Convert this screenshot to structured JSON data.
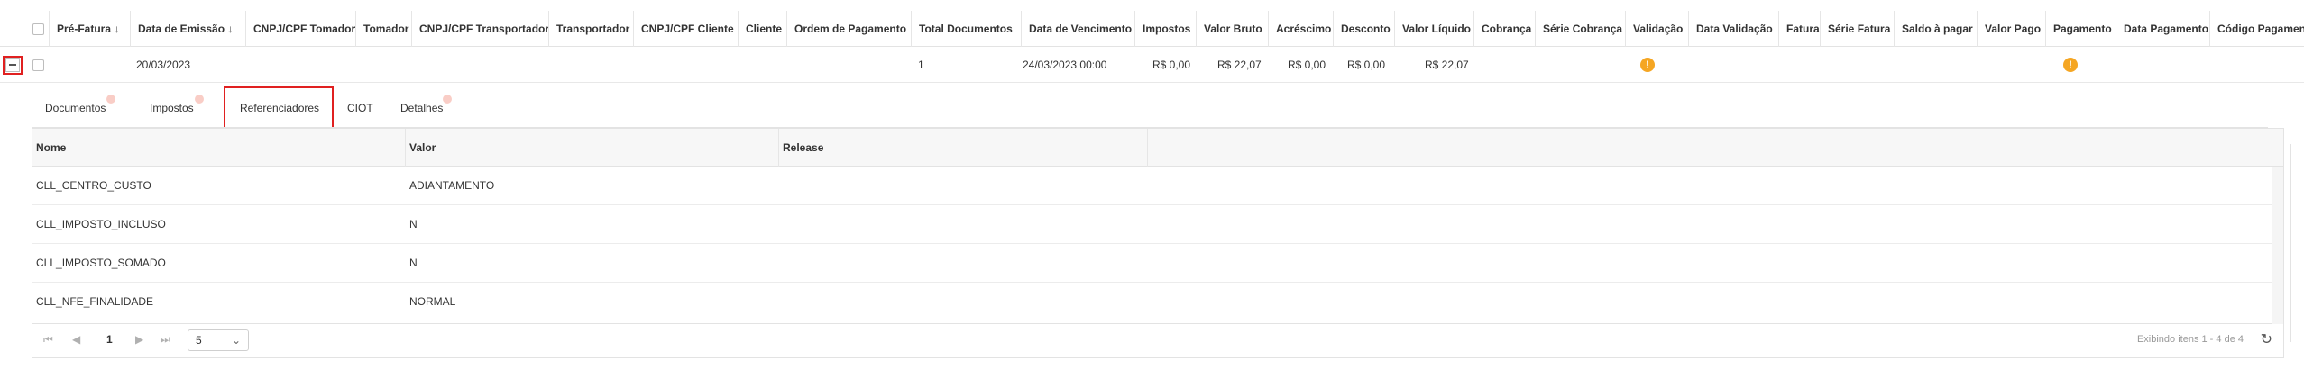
{
  "grid": {
    "columns": [
      "Pré-Fatura ↓",
      "Data de Emissão ↓",
      "CNPJ/CPF Tomador",
      "Tomador",
      "CNPJ/CPF Transportador",
      "Transportador",
      "CNPJ/CPF Cliente",
      "Cliente",
      "Ordem de Pagamento",
      "Total Documentos",
      "Data de Vencimento",
      "Impostos",
      "Valor Bruto",
      "Acréscimo",
      "Desconto",
      "Valor Líquido",
      "Cobrança",
      "Série Cobrança",
      "Validação",
      "Data Validação",
      "Fatura",
      "Série Fatura",
      "Saldo à pagar",
      "Valor Pago",
      "Pagamento",
      "Data Pagamento",
      "Código Pagamento"
    ],
    "row": {
      "data_emissao": "20/03/2023",
      "total_documentos": "1",
      "data_vencimento": "24/03/2023 00:00",
      "impostos": "R$ 0,00",
      "valor_bruto": "R$ 22,07",
      "acrescimo": "R$ 0,00",
      "desconto": "R$ 0,00",
      "valor_liquido": "R$ 22,07",
      "validacao_icon": "warning-icon",
      "pagamento_icon": "warning-icon",
      "warn_glyph": "!"
    }
  },
  "tabs": [
    {
      "label": "Documentos",
      "badge": true
    },
    {
      "label": "Impostos",
      "badge": true
    },
    {
      "label": "Referenciadores",
      "badge": false,
      "selected": true
    },
    {
      "label": "CIOT",
      "badge": false
    },
    {
      "label": "Detalhes",
      "badge": true
    }
  ],
  "detail": {
    "columns": [
      "Nome",
      "Valor",
      "Release"
    ],
    "rows": [
      {
        "nome": "CLL_CENTRO_CUSTO",
        "valor": "ADIANTAMENTO",
        "release": ""
      },
      {
        "nome": "CLL_IMPOSTO_INCLUSO",
        "valor": "N",
        "release": ""
      },
      {
        "nome": "CLL_IMPOSTO_SOMADO",
        "valor": "N",
        "release": ""
      },
      {
        "nome": "CLL_NFE_FINALIDADE",
        "valor": "NORMAL",
        "release": ""
      }
    ]
  },
  "pager": {
    "current_page": "1",
    "page_size": "5",
    "info": "Exibindo itens 1 - 4 de 4",
    "first_glyph": "⏮",
    "prev_glyph": "◀",
    "next_glyph": "▶",
    "last_glyph": "⏭",
    "caret_glyph": "⌄",
    "refresh_glyph": "↻"
  },
  "colors": {
    "highlight": "#e02020",
    "warning": "#f5a623"
  }
}
